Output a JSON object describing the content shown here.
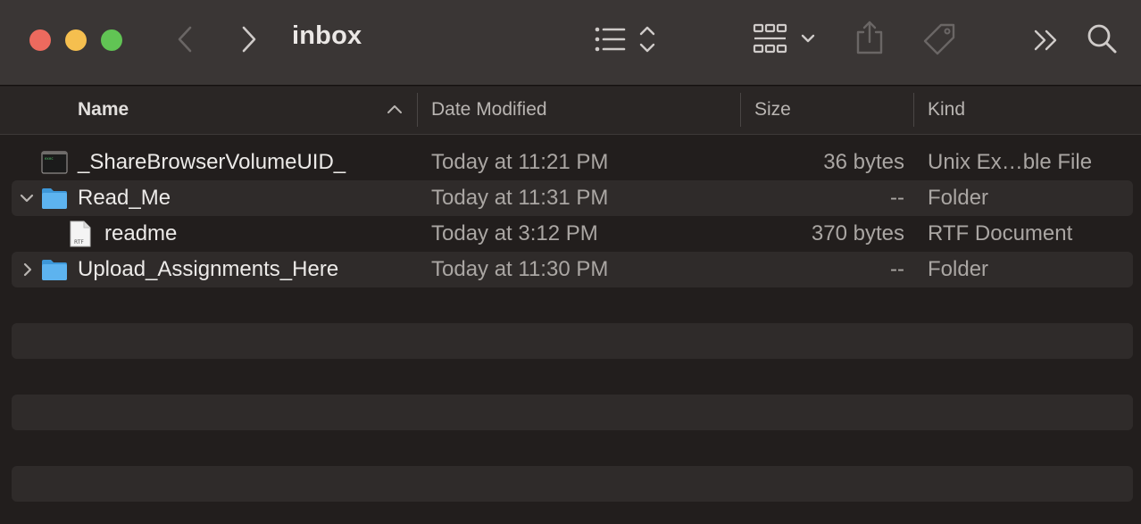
{
  "window": {
    "title": "inbox"
  },
  "toolbar": {
    "icons": [
      "back-icon",
      "forward-icon",
      "list-view-icon",
      "group-icon",
      "share-icon",
      "tag-icon",
      "more-icon",
      "search-icon"
    ]
  },
  "columns": {
    "name": "Name",
    "date": "Date Modified",
    "size": "Size",
    "kind": "Kind"
  },
  "files": [
    {
      "name": "_ShareBrowserVolumeUID_",
      "date": "Today at 11:21 PM",
      "size": "36 bytes",
      "kind": "Unix Ex…ble File",
      "icon": "terminal-file-icon",
      "expanded": null
    },
    {
      "name": "Read_Me",
      "date": "Today at 11:31 PM",
      "size": "--",
      "kind": "Folder",
      "icon": "folder-icon",
      "expanded": true
    },
    {
      "name": "readme",
      "date": "Today at 3:12 PM",
      "size": "370 bytes",
      "kind": "RTF Document",
      "icon": "rtf-document-icon",
      "expanded": null
    },
    {
      "name": "Upload_Assignments_Here",
      "date": "Today at 11:30 PM",
      "size": "--",
      "kind": "Folder",
      "icon": "folder-icon",
      "expanded": false
    }
  ],
  "colors": {
    "accent_folder": "#5db3ef",
    "close": "#ed6a5e",
    "minimize": "#f5bf4f",
    "maximize": "#61c454"
  }
}
